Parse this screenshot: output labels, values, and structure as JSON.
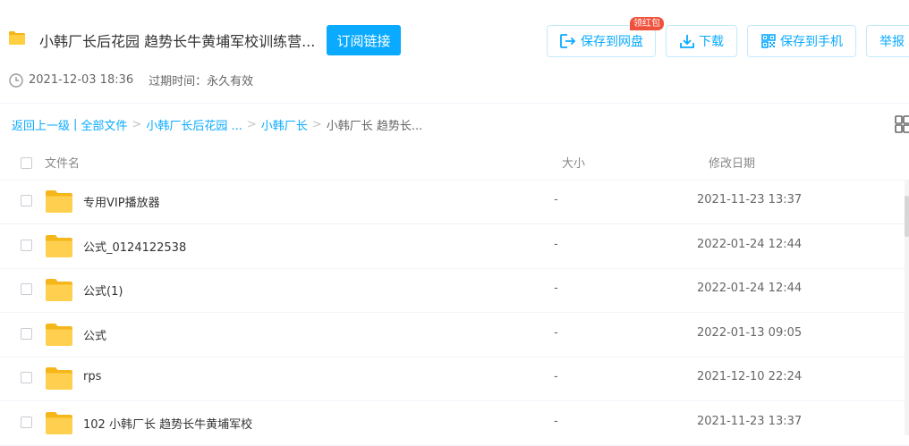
{
  "header": {
    "title": "小韩厂长后花园 趋势长牛黄埔军校训练营...",
    "subscribe_label": "订阅链接",
    "created": "2021-12-03 18:36",
    "expiry": "过期时间：永久有效"
  },
  "toolbar": {
    "badge": "领红包",
    "save_label": "保存到网盘",
    "download_label": "下载",
    "phone_label": "保存到手机",
    "report_label": "举报"
  },
  "breadcrumb": {
    "back": "返回上一级",
    "all": "全部文件",
    "level1": "小韩厂长后花园 ...",
    "level2": "小韩厂长",
    "current": "小韩厂长 趋势长..."
  },
  "table": {
    "columns": {
      "name": "文件名",
      "size": "大小",
      "date": "修改日期"
    },
    "rows": [
      {
        "name": "专用VIP播放器",
        "size": "-",
        "date": "2021-11-23 13:37"
      },
      {
        "name": "公式_0124122538",
        "size": "-",
        "date": "2022-01-24 12:44"
      },
      {
        "name": "公式(1)",
        "size": "-",
        "date": "2022-01-24 12:44"
      },
      {
        "name": "公式",
        "size": "-",
        "date": "2022-01-13 09:05"
      },
      {
        "name": "rps",
        "size": "-",
        "date": "2021-12-10 22:24"
      },
      {
        "name": "102 小韩厂长 趋势长牛黄埔军校",
        "size": "-",
        "date": "2021-11-23 13:37"
      }
    ]
  },
  "icons": {
    "title_folder": "folder-icon",
    "clock": "clock-icon",
    "save": "save-to-cloud-icon",
    "download": "download-icon",
    "phone": "qr-phone-icon",
    "grid": "grid-view-icon",
    "row_folder": "folder-icon"
  },
  "colors": {
    "accent": "#09aaff",
    "badge": "#f0513c",
    "folder": "#ffd050"
  }
}
